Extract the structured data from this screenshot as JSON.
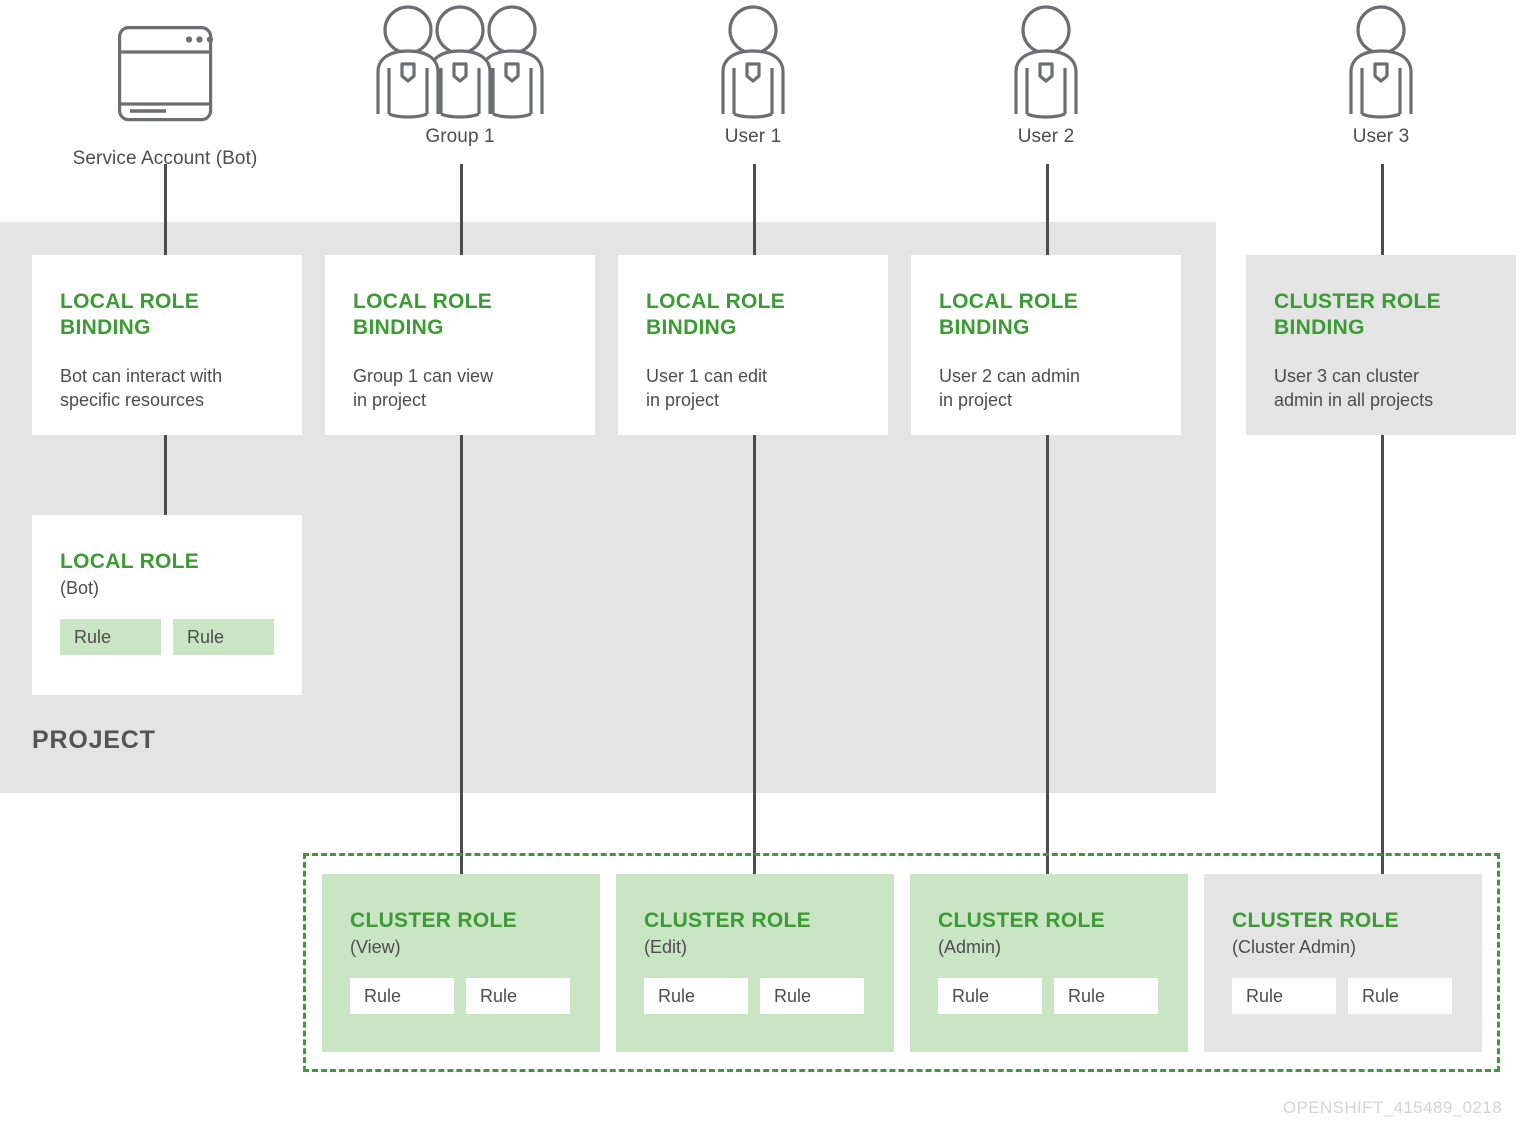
{
  "diagram": {
    "footer_code": "OPENSHIFT_415489_0218",
    "project_label": "PROJECT",
    "accent_green": "#3c9b35",
    "light_green": "#c9e5c4",
    "gray": "#e4e4e4",
    "line_gray": "#4d4d4d"
  },
  "actors": [
    {
      "id": "service-account",
      "icon": "browser-window-icon",
      "label": "Service Account (Bot)"
    },
    {
      "id": "group-1",
      "icon": "group-of-users-icon",
      "label": "Group 1"
    },
    {
      "id": "user-1",
      "icon": "user-icon",
      "label": "User 1"
    },
    {
      "id": "user-2",
      "icon": "user-icon",
      "label": "User 2"
    },
    {
      "id": "user-3",
      "icon": "user-icon",
      "label": "User 3"
    }
  ],
  "bindings": [
    {
      "id": "local-role-binding-bot",
      "title": "LOCAL ROLE\nBINDING",
      "desc": "Bot can interact with\nspecific resources"
    },
    {
      "id": "local-role-binding-group1",
      "title": "LOCAL ROLE\nBINDING",
      "desc": "Group 1 can view\nin project"
    },
    {
      "id": "local-role-binding-user1",
      "title": "LOCAL ROLE\nBINDING",
      "desc": "User 1 can edit\nin project"
    },
    {
      "id": "local-role-binding-user2",
      "title": "LOCAL ROLE\nBINDING",
      "desc": "User 2 can admin\nin project"
    },
    {
      "id": "cluster-role-binding-user3",
      "title": "CLUSTER ROLE\nBINDING",
      "desc": "User 3 can cluster\nadmin in all projects"
    }
  ],
  "local_role": {
    "title": "LOCAL ROLE",
    "subtitle": "(Bot)",
    "rules": [
      "Rule",
      "Rule"
    ]
  },
  "cluster_roles": [
    {
      "id": "cluster-role-view",
      "title": "CLUSTER ROLE",
      "subtitle": "(View)",
      "rules": [
        "Rule",
        "Rule"
      ]
    },
    {
      "id": "cluster-role-edit",
      "title": "CLUSTER ROLE",
      "subtitle": "(Edit)",
      "rules": [
        "Rule",
        "Rule"
      ]
    },
    {
      "id": "cluster-role-admin",
      "title": "CLUSTER ROLE",
      "subtitle": "(Admin)",
      "rules": [
        "Rule",
        "Rule"
      ]
    },
    {
      "id": "cluster-role-cluster-admin",
      "title": "CLUSTER ROLE",
      "subtitle": "(Cluster Admin)",
      "rules": [
        "Rule",
        "Rule"
      ]
    }
  ]
}
